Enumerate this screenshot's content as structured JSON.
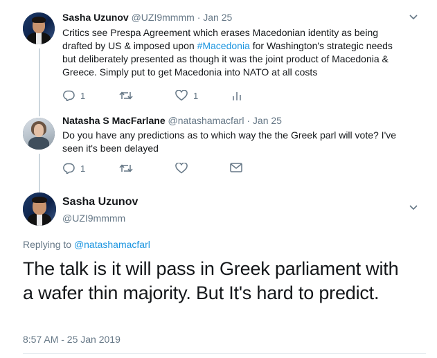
{
  "tweet1": {
    "name": "Sasha Uzunov",
    "handle": "@UZI9mmmm",
    "sep": "·",
    "time": "Jan 25",
    "text_before": "Critics see Prespa Agreement which erases Macedonian identity as being drafted by US & imposed upon ",
    "hashtag": "#Macedonia",
    "text_after": " for Washington's strategic needs but deliberately presented as though it was the joint product of Macedonia & Greece. Simply put to get Macedonia into NATO at all costs",
    "reply_count": "1",
    "retweet_count": "",
    "like_count": "1"
  },
  "tweet2": {
    "name": "Natasha S MacFarlane",
    "handle": "@natashamacfarl",
    "sep": "·",
    "time": "Jan 25",
    "text": "Do you have any predictions as to which way the the Greek parl will vote? I've seen it's been delayed",
    "reply_count": "1",
    "retweet_count": "",
    "like_count": ""
  },
  "main_tweet": {
    "name": "Sasha Uzunov",
    "handle": "@UZI9mmmm",
    "replying_prefix": "Replying to ",
    "replying_to": "@natashamacfarl",
    "text": "The talk is it will pass in Greek parliament with a wafer thin majority.  But It's hard to predict.",
    "timestamp": "8:57 AM - 25 Jan 2019"
  },
  "icons": {
    "reply": "reply-icon",
    "retweet": "retweet-icon",
    "like": "heart-icon",
    "stats": "analytics-icon",
    "dm": "envelope-icon",
    "caret": "chevron-down-icon"
  },
  "colors": {
    "link": "#1b95e0",
    "secondary": "#657786",
    "thread_line": "#ccd6dd"
  }
}
